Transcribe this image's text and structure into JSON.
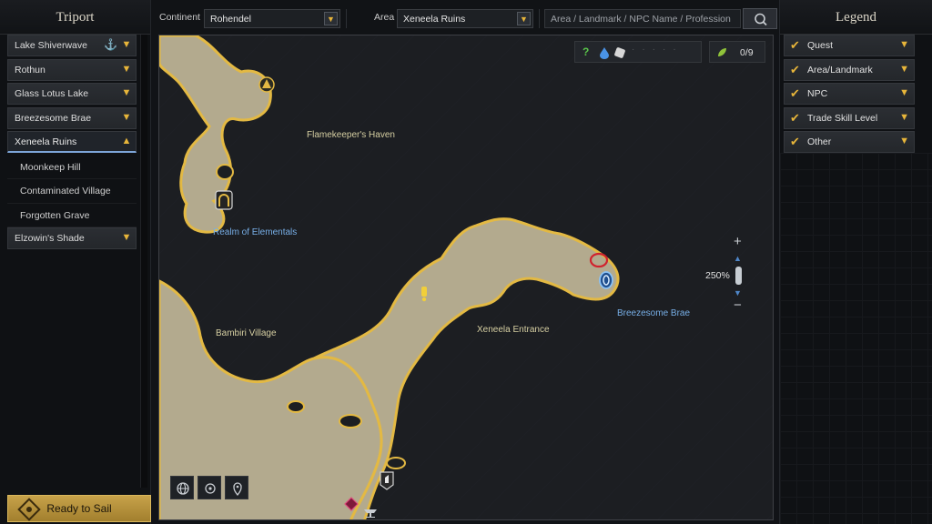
{
  "triport": {
    "title": "Triport",
    "items": [
      {
        "label": "Lake Shiverwave",
        "anchor": true
      },
      {
        "label": "Rothun"
      },
      {
        "label": "Glass Lotus Lake"
      },
      {
        "label": "Breezesome Brae"
      },
      {
        "label": "Xeneela Ruins",
        "expanded": true,
        "children": [
          "Moonkeep Hill",
          "Contaminated Village",
          "Forgotten Grave"
        ]
      },
      {
        "label": "Elzowin's Shade"
      }
    ],
    "sail_button": "Ready to Sail"
  },
  "filters": {
    "continent_label": "Continent",
    "continent_value": "Rohendel",
    "area_label": "Area",
    "area_value": "Xeneela Ruins",
    "search_placeholder": "Area / Landmark / NPC Name / Profession"
  },
  "map": {
    "labels": {
      "flamekeeper": "Flamekeeper's Haven",
      "realm": "Realm of Elementals",
      "bambiri": "Bambiri Village",
      "entrance": "Xeneela Entrance",
      "brae": "Breezesome Brae"
    },
    "collect_count": "0/9",
    "zoom_level": "250%"
  },
  "legend": {
    "title": "Legend",
    "items": [
      "Quest",
      "Area/Landmark",
      "NPC",
      "Trade Skill Level",
      "Other"
    ]
  },
  "colors": {
    "accent": "#e7b53a",
    "highlight_blue": "#7da5d8",
    "terrain_fill": "#b3aa8e",
    "terrain_edge": "#e3b943"
  }
}
